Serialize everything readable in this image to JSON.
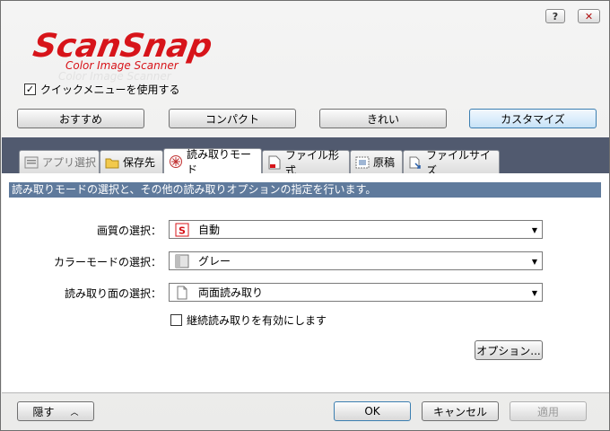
{
  "title_bar": {
    "help_label": "?",
    "close_label": "✕"
  },
  "logo": {
    "main": "ScanSnap",
    "sub": "Color Image Scanner",
    "brand_color": "#d7141a"
  },
  "quick_menu": {
    "label": "クイックメニューを使用する",
    "checked": true
  },
  "presets": [
    {
      "label": "おすすめ"
    },
    {
      "label": "コンパクト"
    },
    {
      "label": "きれい"
    },
    {
      "label": "カスタマイズ"
    }
  ],
  "tabs": [
    {
      "label": "アプリ選択",
      "icon": "app-select-icon"
    },
    {
      "label": "保存先",
      "icon": "folder-icon"
    },
    {
      "label": "読み取りモード",
      "icon": "scan-mode-icon"
    },
    {
      "label": "ファイル形式",
      "icon": "file-format-icon"
    },
    {
      "label": "原稿",
      "icon": "paper-icon"
    },
    {
      "label": "ファイルサイズ",
      "icon": "file-size-icon"
    }
  ],
  "active_tab": "読み取りモード",
  "description": "読み取りモードの選択と、その他の読み取りオプションの指定を行います。",
  "fields": {
    "quality": {
      "label": "画質の選択：",
      "value": "自動"
    },
    "color_mode": {
      "label": "カラーモードの選択：",
      "value": "グレー"
    },
    "scan_side": {
      "label": "読み取り面の選択：",
      "value": "両面読み取り"
    }
  },
  "continuous_scan": {
    "label": "継続読み取りを有効にします",
    "checked": false
  },
  "options_button": "オプション...",
  "footer": {
    "hide_label": "隠す",
    "ok_label": "OK",
    "cancel_label": "キャンセル",
    "apply_label": "適用"
  },
  "colors": {
    "tab_band": "#515a6f",
    "description_bar": "#5f7a9c",
    "selected_preset": "#d9ecfb"
  }
}
